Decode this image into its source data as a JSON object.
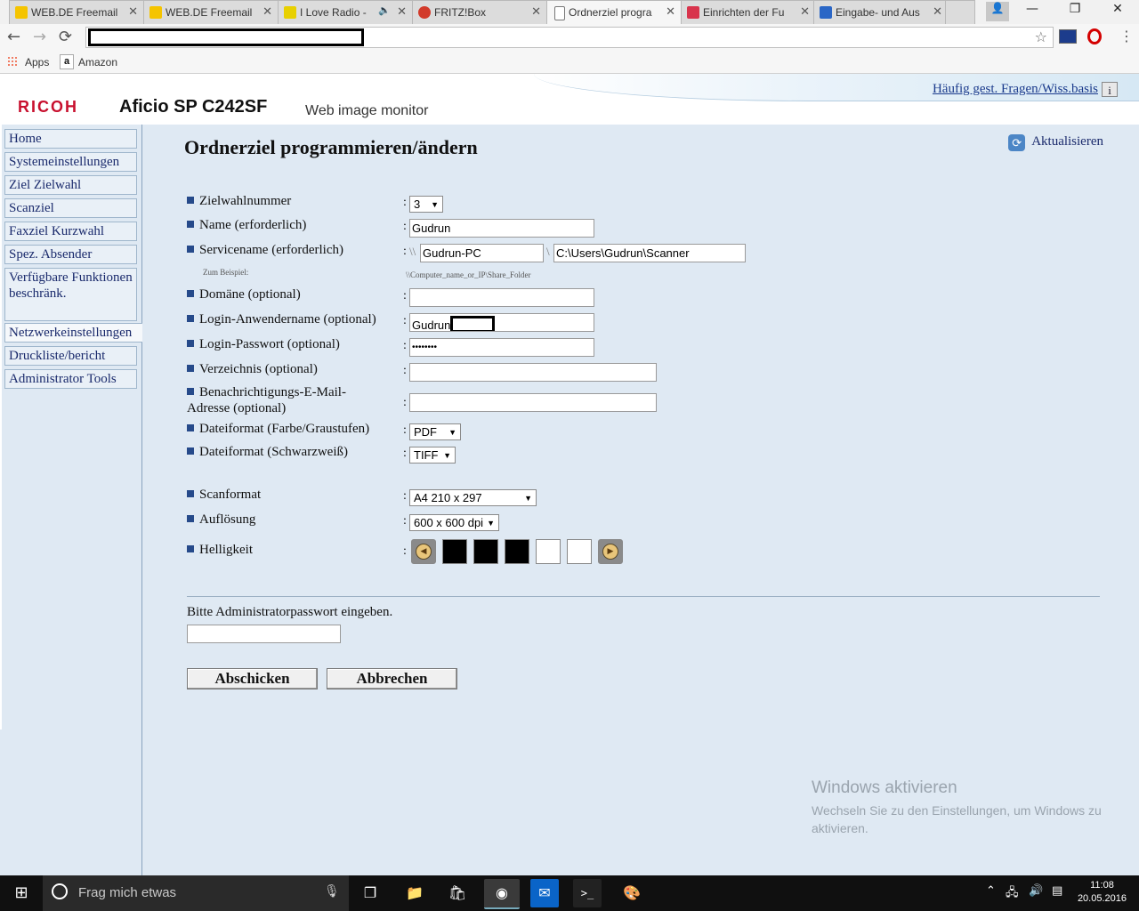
{
  "browser": {
    "tabs": [
      {
        "title": "WEB.DE Freemail",
        "favicon_color": "#f5c400"
      },
      {
        "title": "WEB.DE Freemail",
        "favicon_color": "#f5c400"
      },
      {
        "title": "I Love Radio -",
        "favicon_color": "#e8d000"
      },
      {
        "title": "FRITZ!Box",
        "favicon_color": "#d23a2a"
      },
      {
        "title": "Ordnerziel progra",
        "favicon_color": "#ffffff"
      },
      {
        "title": "Einrichten der Fu",
        "favicon_color": "#d8344c"
      },
      {
        "title": "Eingabe- und Aus",
        "favicon_color": "#2a66c6"
      }
    ],
    "window_controls": {
      "minimize": "—",
      "maximize": "❐",
      "close": "✕"
    },
    "nav": {
      "back": "←",
      "forward": "→",
      "reload": "⟳"
    },
    "bookmarks": [
      {
        "label": "Apps",
        "icon": "apps-grid-icon"
      },
      {
        "label": "Amazon",
        "icon": "amazon-icon"
      }
    ]
  },
  "header": {
    "brand": "RICOH",
    "model": "Aficio SP C242SF",
    "subtitle": "Web image monitor",
    "faq_link": "Häufig gest. Fragen/Wiss.basis",
    "info_icon": "i"
  },
  "sidebar": {
    "items": [
      {
        "label": "Home"
      },
      {
        "label": "Systemeinstellungen"
      },
      {
        "label": "Ziel Zielwahl"
      },
      {
        "label": "Scanziel"
      },
      {
        "label": "Faxziel Kurzwahl"
      },
      {
        "label": "Spez. Absender"
      },
      {
        "label": "Verfügbare Funktionen beschränk."
      },
      {
        "label": "Netzwerkeinstellungen"
      },
      {
        "label": "Druckliste/bericht"
      },
      {
        "label": "Administrator Tools"
      }
    ]
  },
  "main": {
    "title": "Ordnerziel programmieren/ändern",
    "refresh_label": "Aktualisieren",
    "fields": {
      "zielwahlnummer": {
        "label": "Zielwahlnummer",
        "value": "3"
      },
      "name": {
        "label": "Name (erforderlich)",
        "value": "Gudrun"
      },
      "servicename": {
        "label": "Servicename (erforderlich)",
        "prefix": "\\\\",
        "host": "Gudrun-PC",
        "sep": "\\",
        "path": "C:\\Users\\Gudrun\\Scanner"
      },
      "example": {
        "label": "Zum Beispiel:",
        "value": "\\\\Computer_name_or_IP\\Share_Folder"
      },
      "domaene": {
        "label": "Domäne (optional)",
        "value": ""
      },
      "login_name": {
        "label": "Login-Anwendername (optional)",
        "value": "Gudrun"
      },
      "login_pass": {
        "label": "Login-Passwort (optional)",
        "value": "••••••••"
      },
      "verzeichnis": {
        "label": "Verzeichnis (optional)",
        "value": ""
      },
      "email": {
        "label": "Benachrichtigungs-E-Mail-Adresse (optional)",
        "value": ""
      },
      "format_farbe": {
        "label": "Dateiformat (Farbe/Graustufen)",
        "value": "PDF"
      },
      "format_sw": {
        "label": "Dateiformat (Schwarzweiß)",
        "value": "TIFF"
      },
      "scanformat": {
        "label": "Scanformat",
        "value": "A4 210 x 297"
      },
      "aufloesung": {
        "label": "Auflösung",
        "value": "600 x 600 dpi"
      },
      "helligkeit": {
        "label": "Helligkeit",
        "level": 3,
        "max": 5
      }
    },
    "colon": ":",
    "admin_prompt": "Bitte Administratorpasswort eingeben.",
    "admin_value": "",
    "submit_label": "Abschicken",
    "cancel_label": "Abbrechen"
  },
  "watermark": {
    "title": "Windows aktivieren",
    "text": "Wechseln Sie zu den Einstellungen, um Windows zu aktivieren."
  },
  "taskbar": {
    "search_placeholder": "Frag mich etwas",
    "time": "11:08",
    "date": "20.05.2016"
  }
}
